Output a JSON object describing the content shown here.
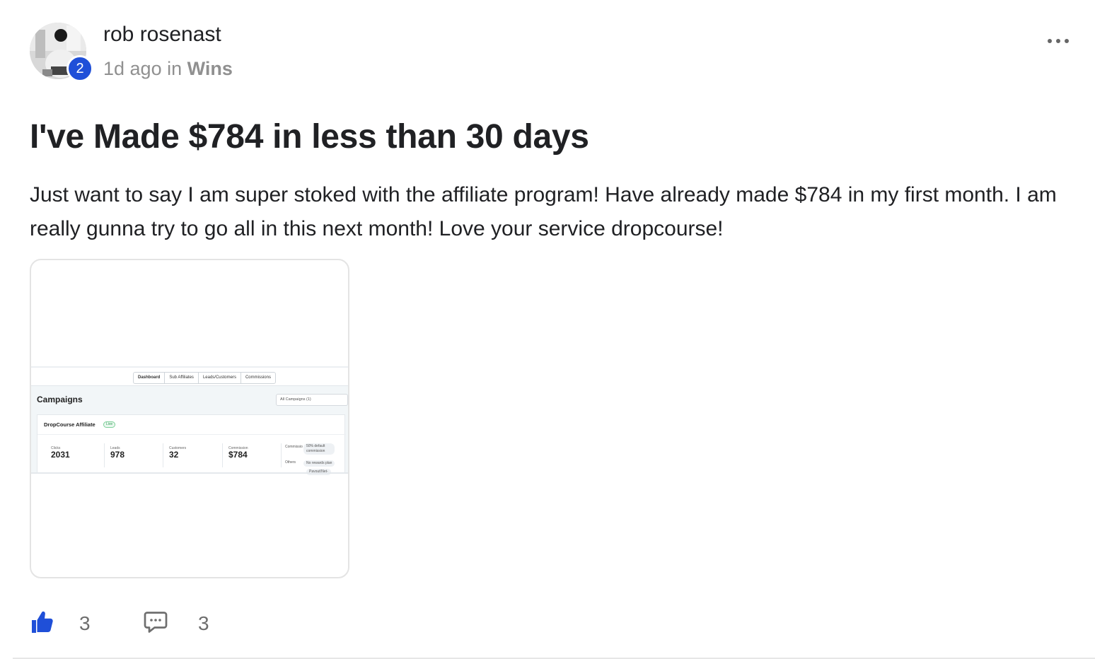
{
  "author": {
    "name": "rob rosenast",
    "level": "2",
    "time_ago": "1d ago",
    "in_word": "in",
    "category": "Wins"
  },
  "post": {
    "title": "I've Made $784 in less than 30 days",
    "body": "Just want to say I am super stoked with the affiliate program! Have already made $784 in my first month. I am really gunna try to go all in this next month! Love your service dropcourse!"
  },
  "attachment": {
    "nav_tabs": [
      "Dashboard",
      "Sub Affiliates",
      "Leads/Customers",
      "Commissions"
    ],
    "heading": "Campaigns",
    "select_value": "All Campaigns (1)",
    "campaign_name": "DropCourse Affiliate",
    "status": "Live",
    "stats": [
      {
        "label": "Clicks",
        "value": "2031"
      },
      {
        "label": "Leads",
        "value": "978"
      },
      {
        "label": "Customers",
        "value": "32"
      },
      {
        "label": "Commission",
        "value": "$784"
      }
    ],
    "side_labels": {
      "commission": "Commissio",
      "others": "Others"
    },
    "pills": [
      "50% default commission",
      "No rewards plan",
      "Payout(Net-"
    ]
  },
  "actions": {
    "like_count": "3",
    "comment_count": "3"
  },
  "colors": {
    "accent": "#1f4fd8",
    "meta": "#909090",
    "text": "#202124"
  }
}
